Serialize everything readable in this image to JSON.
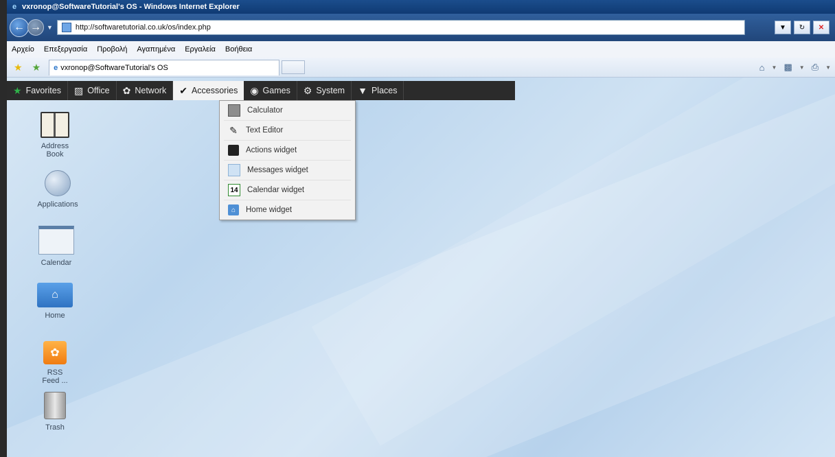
{
  "window": {
    "title": "vxronop@SoftwareTutorial's OS - Windows Internet Explorer",
    "url": "http://softwaretutorial.co.uk/os/index.php"
  },
  "ie_menu": [
    "Αρχείο",
    "Επεξεργασία",
    "Προβολή",
    "Αγαπημένα",
    "Εργαλεία",
    "Βοήθεια"
  ],
  "tab": {
    "title": "vxronop@SoftwareTutorial's OS"
  },
  "appbar": {
    "items": [
      "Favorites",
      "Office",
      "Network",
      "Accessories",
      "Games",
      "System",
      "Places"
    ],
    "active": "Accessories"
  },
  "accessories_menu": {
    "items": [
      "Calculator",
      "Text Editor",
      "Actions widget",
      "Messages widget",
      "Calendar widget",
      "Home widget"
    ],
    "calendar_day": "14"
  },
  "desktop": {
    "icons": [
      "Address Book",
      "Applications",
      "Calendar",
      "Home",
      "RSS Feed ...",
      "Trash"
    ],
    "address_book_lines": [
      "Address",
      "Book"
    ],
    "rss_lines": [
      "RSS",
      "Feed ..."
    ]
  },
  "colors": {
    "appbar_bg": "#2b2b2b",
    "desktop_bg": "#c4dcf0",
    "favorites_icon": "#2fb34a"
  },
  "icons": {
    "favorites": "star-icon",
    "office": "briefcase-icon",
    "network": "rss-icon",
    "accessories": "check-circle-icon",
    "games": "gamepad-icon",
    "system": "gear-icon",
    "places": "folder-icon"
  }
}
